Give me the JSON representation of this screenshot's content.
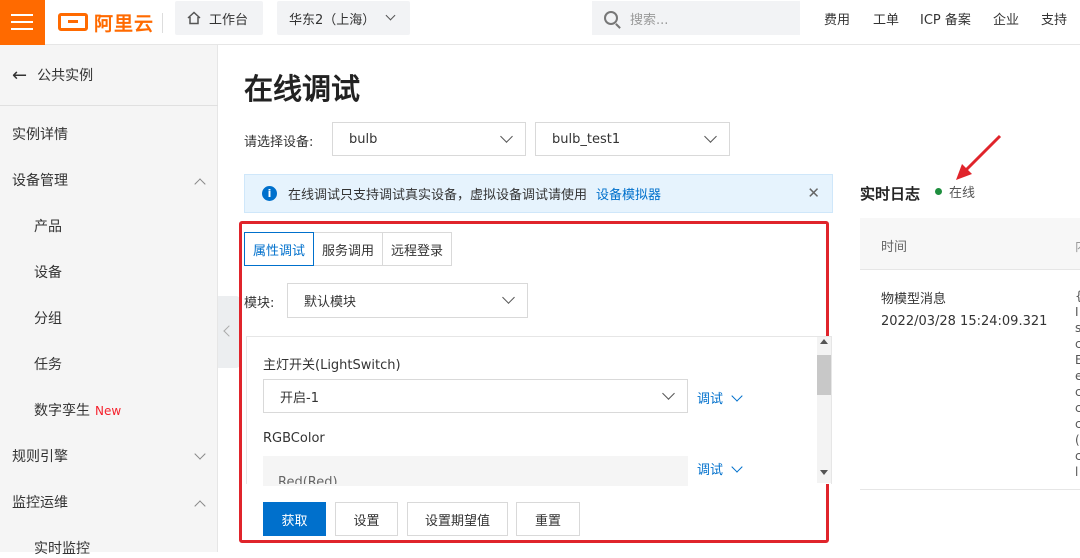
{
  "topbar": {
    "logo_text": "阿里云",
    "workbench": "工作台",
    "region": "华东2（上海）",
    "search_placeholder": "搜索...",
    "links": [
      "费用",
      "工单",
      "ICP 备案",
      "企业",
      "支持"
    ]
  },
  "sidebar": {
    "back_label": "公共实例",
    "items": [
      {
        "label": "实例详情"
      },
      {
        "label": "设备管理"
      },
      {
        "label": "产品"
      },
      {
        "label": "设备"
      },
      {
        "label": "分组"
      },
      {
        "label": "任务"
      },
      {
        "label": "数字孪生",
        "badge": "New"
      },
      {
        "label": "规则引擎"
      },
      {
        "label": "监控运维"
      },
      {
        "label": "实时监控"
      }
    ]
  },
  "main": {
    "title": "在线调试",
    "device_label": "请选择设备:",
    "product_select": "bulb",
    "device_select": "bulb_test1",
    "notice_text": "在线调试只支持调试真实设备，虚拟设备调试请使用",
    "notice_link": "设备模拟器",
    "tabs": [
      "属性调试",
      "服务调用",
      "远程登录"
    ],
    "module_label": "模块:",
    "module_value": "默认模块",
    "props": [
      {
        "label": "主灯开关(LightSwitch)",
        "value": "开启-1",
        "action": "调试"
      },
      {
        "label": "RGBColor",
        "sub_label": "Red(Red)",
        "action": "调试"
      }
    ],
    "buttons": [
      "获取",
      "设置",
      "设置期望值",
      "重置"
    ]
  },
  "log": {
    "title": "实时日志",
    "status": "在线",
    "status_color": "#1e8e3e",
    "col_time": "时间",
    "col_trunc": "内",
    "entry_type": "物模型消息",
    "entry_time": "2022/03/28 15:24:09.321",
    "trunc_chars": [
      "{",
      "I",
      "s",
      "c",
      "E",
      "e",
      "c",
      "c",
      "c",
      "(",
      "c",
      "l"
    ]
  },
  "colors": {
    "brand": "#ff6a00",
    "primary": "#0070cc",
    "highlight": "#e0242b"
  }
}
